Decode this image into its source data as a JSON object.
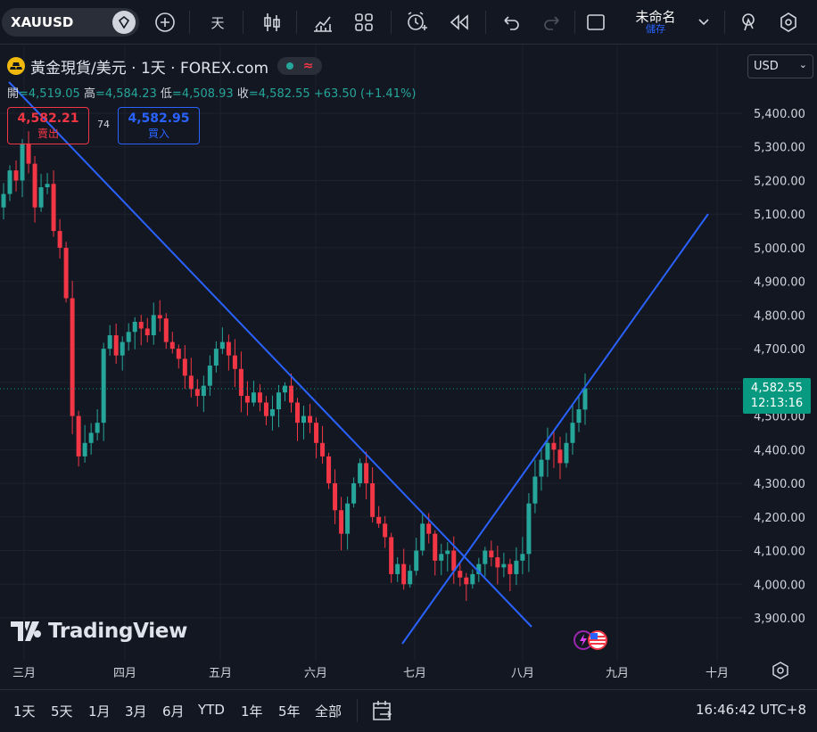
{
  "toolbar": {
    "symbol": "XAUUSD",
    "interval": "天",
    "layout_name": "未命名",
    "save_label": "儲存"
  },
  "legend": {
    "title": "黃金現貨/美元 · 1天 · FOREX.com",
    "open_label": "開",
    "open": "=4,519.05",
    "high_label": "高",
    "high": "=4,584.23",
    "low_label": "低",
    "low": "=4,508.93",
    "close_label": "收",
    "close": "=4,582.55",
    "change": "+63.50 (+1.41%)"
  },
  "trade": {
    "sell_price": "4,582.21",
    "sell_label": "賣出",
    "spread": "74",
    "buy_price": "4,582.95",
    "buy_label": "買入"
  },
  "currency": "USD",
  "last_price": {
    "price": "4,582.55",
    "countdown": "12:13:16"
  },
  "brand": "TradingView",
  "bottom": {
    "ranges": [
      "1天",
      "5天",
      "1月",
      "3月",
      "6月",
      "YTD",
      "1年",
      "5年",
      "全部"
    ],
    "clock": "16:46:42 UTC+8"
  },
  "colors": {
    "up": "#26a69a",
    "down": "#f23645",
    "trendline": "#2962ff",
    "background": "#131722"
  },
  "chart_data": {
    "type": "candlestick",
    "x_tick_labels": [
      "三月",
      "四月",
      "五月",
      "六月",
      "七月",
      "八月",
      "九月",
      "十月"
    ],
    "y_tick_labels": [
      "5,400.00",
      "5,300.00",
      "5,200.00",
      "5,100.00",
      "5,000.00",
      "4,900.00",
      "4,800.00",
      "4,700.00",
      "4,600.00",
      "4,500.00",
      "4,400.00",
      "4,300.00",
      "4,200.00",
      "4,100.00",
      "4,000.00",
      "3,900.00"
    ],
    "ylim": [
      3860,
      5440
    ],
    "last_close": 4582.55,
    "closes": [
      5160,
      5230,
      5200,
      5310,
      5250,
      5120,
      5180,
      5190,
      5050,
      5000,
      4850,
      4500,
      4380,
      4420,
      4450,
      4480,
      4700,
      4740,
      4680,
      4720,
      4750,
      4780,
      4760,
      4740,
      4800,
      4790,
      4720,
      4700,
      4670,
      4620,
      4580,
      4560,
      4590,
      4650,
      4700,
      4720,
      4680,
      4640,
      4560,
      4540,
      4570,
      4540,
      4500,
      4520,
      4570,
      4590,
      4540,
      4480,
      4500,
      4480,
      4420,
      4380,
      4300,
      4220,
      4150,
      4240,
      4300,
      4360,
      4300,
      4200,
      4180,
      4140,
      4030,
      4060,
      4000,
      4040,
      4100,
      4180,
      4150,
      4070,
      4090,
      4100,
      4040,
      4020,
      4000,
      4030,
      4060,
      4100,
      4080,
      4050,
      4060,
      4030,
      4070,
      4090,
      4240,
      4320,
      4370,
      4420,
      4400,
      4360,
      4420,
      4480,
      4520,
      4582.55
    ],
    "trendlines": [
      {
        "from": [
          "2月上旬",
          5520
        ],
        "to": [
          "7月底",
          3880
        ]
      },
      {
        "from": [
          "6月底",
          3880
        ],
        "to": [
          "9月底",
          5110
        ]
      }
    ]
  }
}
